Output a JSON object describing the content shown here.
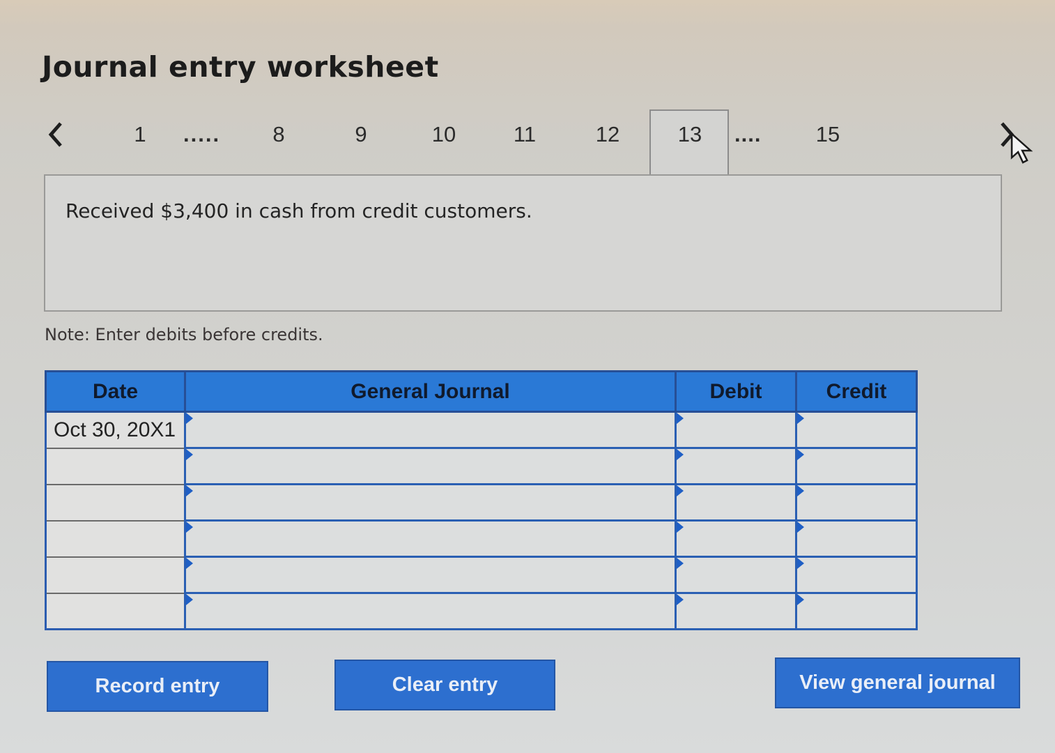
{
  "title": "Journal entry worksheet",
  "pagination": {
    "pages": [
      "1",
      "8",
      "9",
      "10",
      "11",
      "12",
      "13",
      "15"
    ],
    "active": "13",
    "ellipsis": "....."
  },
  "icons": {
    "prev": "chevron-left-icon",
    "next": "chevron-right-icon",
    "cursor": "mouse-pointer-icon"
  },
  "description": "Received $3,400 in cash from credit customers.",
  "note": "Note: Enter debits before credits.",
  "journal": {
    "headers": [
      "Date",
      "General Journal",
      "Debit",
      "Credit"
    ],
    "rows": [
      {
        "date": "Oct 30, 20X1",
        "account": "",
        "debit": "",
        "credit": ""
      },
      {
        "date": "",
        "account": "",
        "debit": "",
        "credit": ""
      },
      {
        "date": "",
        "account": "",
        "debit": "",
        "credit": ""
      },
      {
        "date": "",
        "account": "",
        "debit": "",
        "credit": ""
      },
      {
        "date": "",
        "account": "",
        "debit": "",
        "credit": ""
      },
      {
        "date": "",
        "account": "",
        "debit": "",
        "credit": ""
      }
    ]
  },
  "buttons": {
    "record": "Record entry",
    "clear": "Clear entry",
    "view": "View general journal"
  },
  "colors": {
    "accent": "#2a79d6",
    "border": "#2a5fb3"
  }
}
